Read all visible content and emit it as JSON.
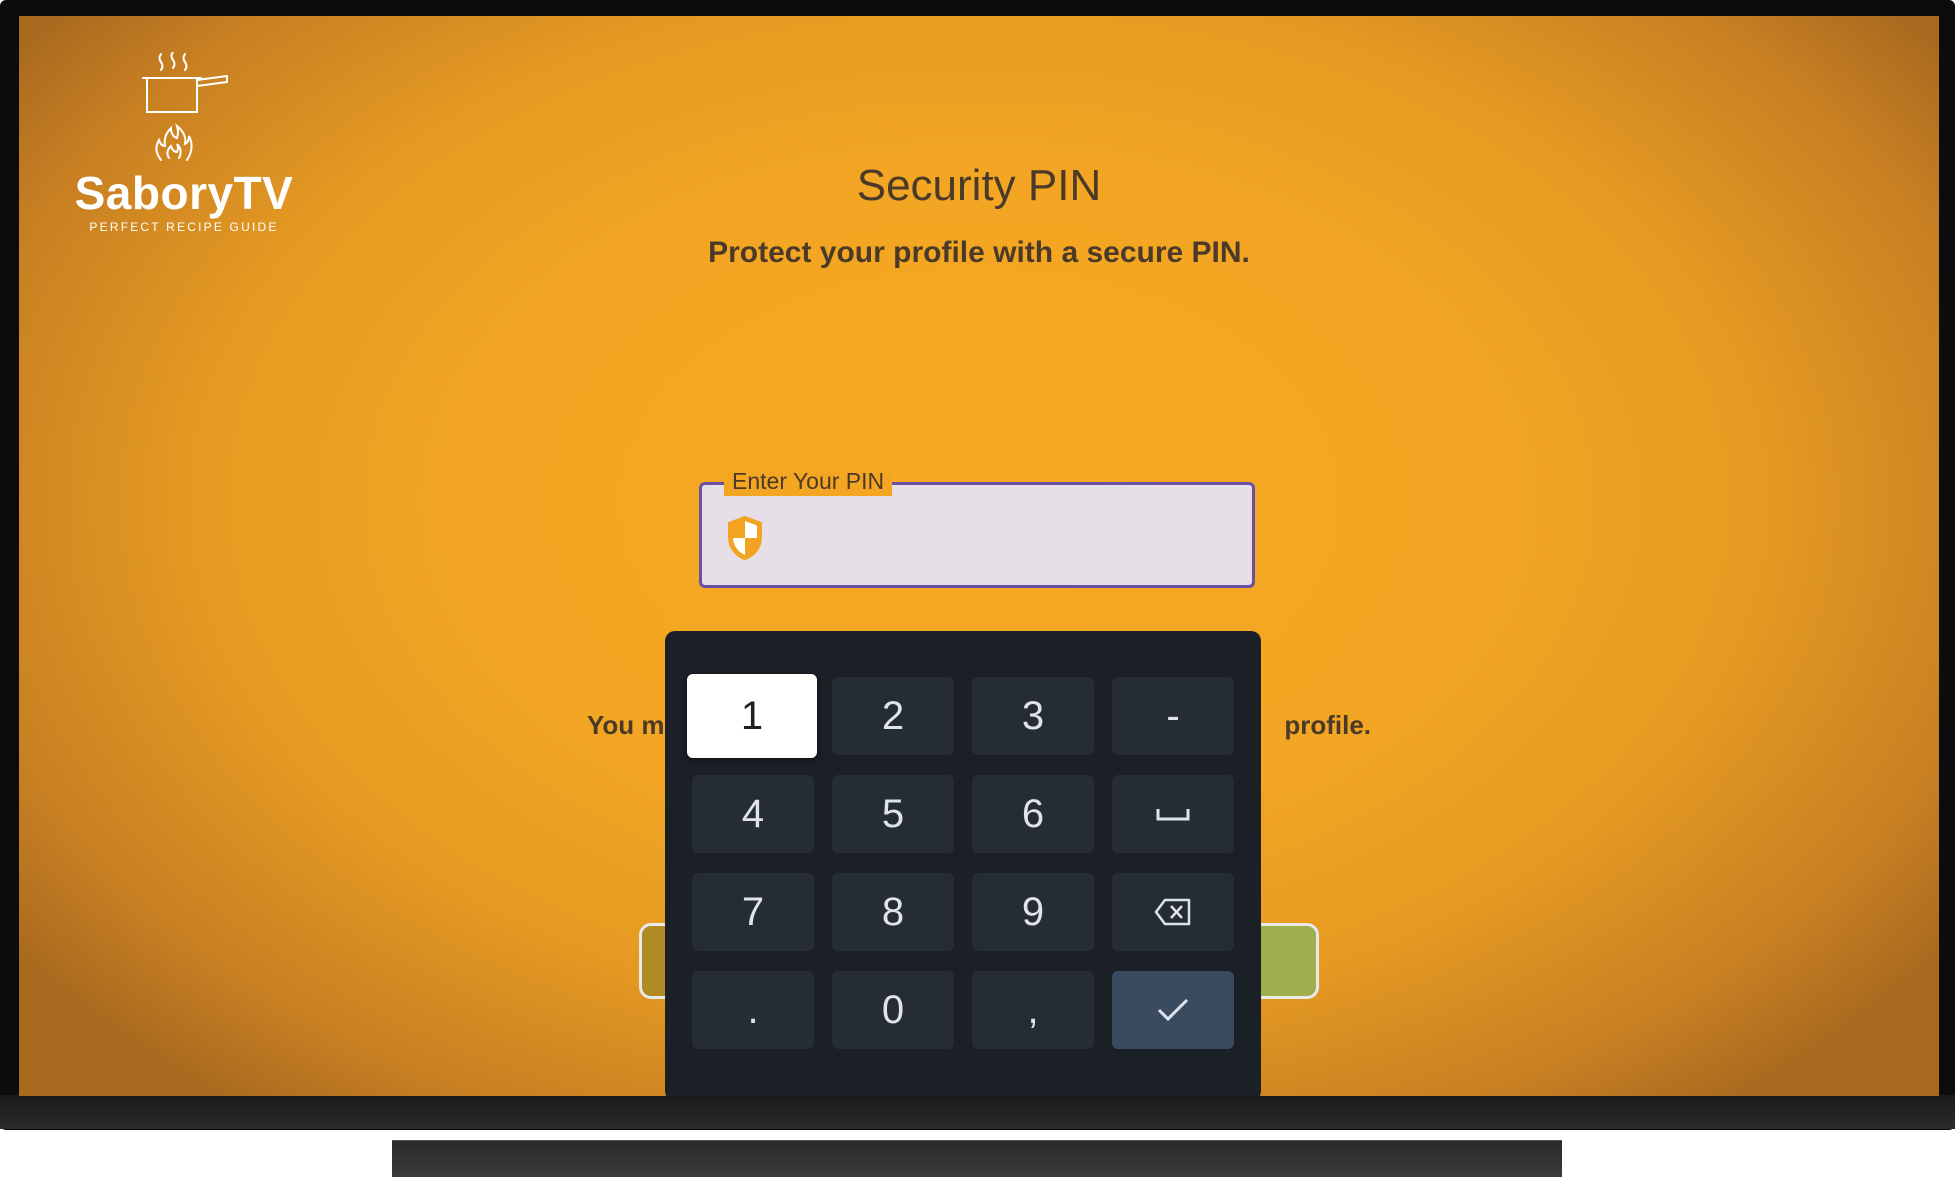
{
  "app": {
    "name": "SaboryTV",
    "tagline": "PERFECT RECIPE GUIDE"
  },
  "page": {
    "title": "Security PIN",
    "subtitle": "Protect your profile with a secure PIN."
  },
  "pin_field": {
    "label": "Enter Your PIN",
    "value": "",
    "icon": "shield-icon"
  },
  "hint": {
    "left_visible": "You mu",
    "right_visible": "profile."
  },
  "keyboard": {
    "keys": [
      "1",
      "2",
      "3",
      "-",
      "4",
      "5",
      "6",
      "space",
      "7",
      "8",
      "9",
      "backspace",
      ".",
      "0",
      ",",
      "confirm"
    ],
    "focused_key": "1"
  },
  "colors": {
    "background": "#f4a623",
    "field_border": "#6a4fa3",
    "field_fill": "#e6dfe8",
    "keyboard_bg": "#1b1f26",
    "key_bg": "#262c35",
    "confirm_key_bg": "#3b4b5f",
    "text_dark": "#4b3a28"
  }
}
